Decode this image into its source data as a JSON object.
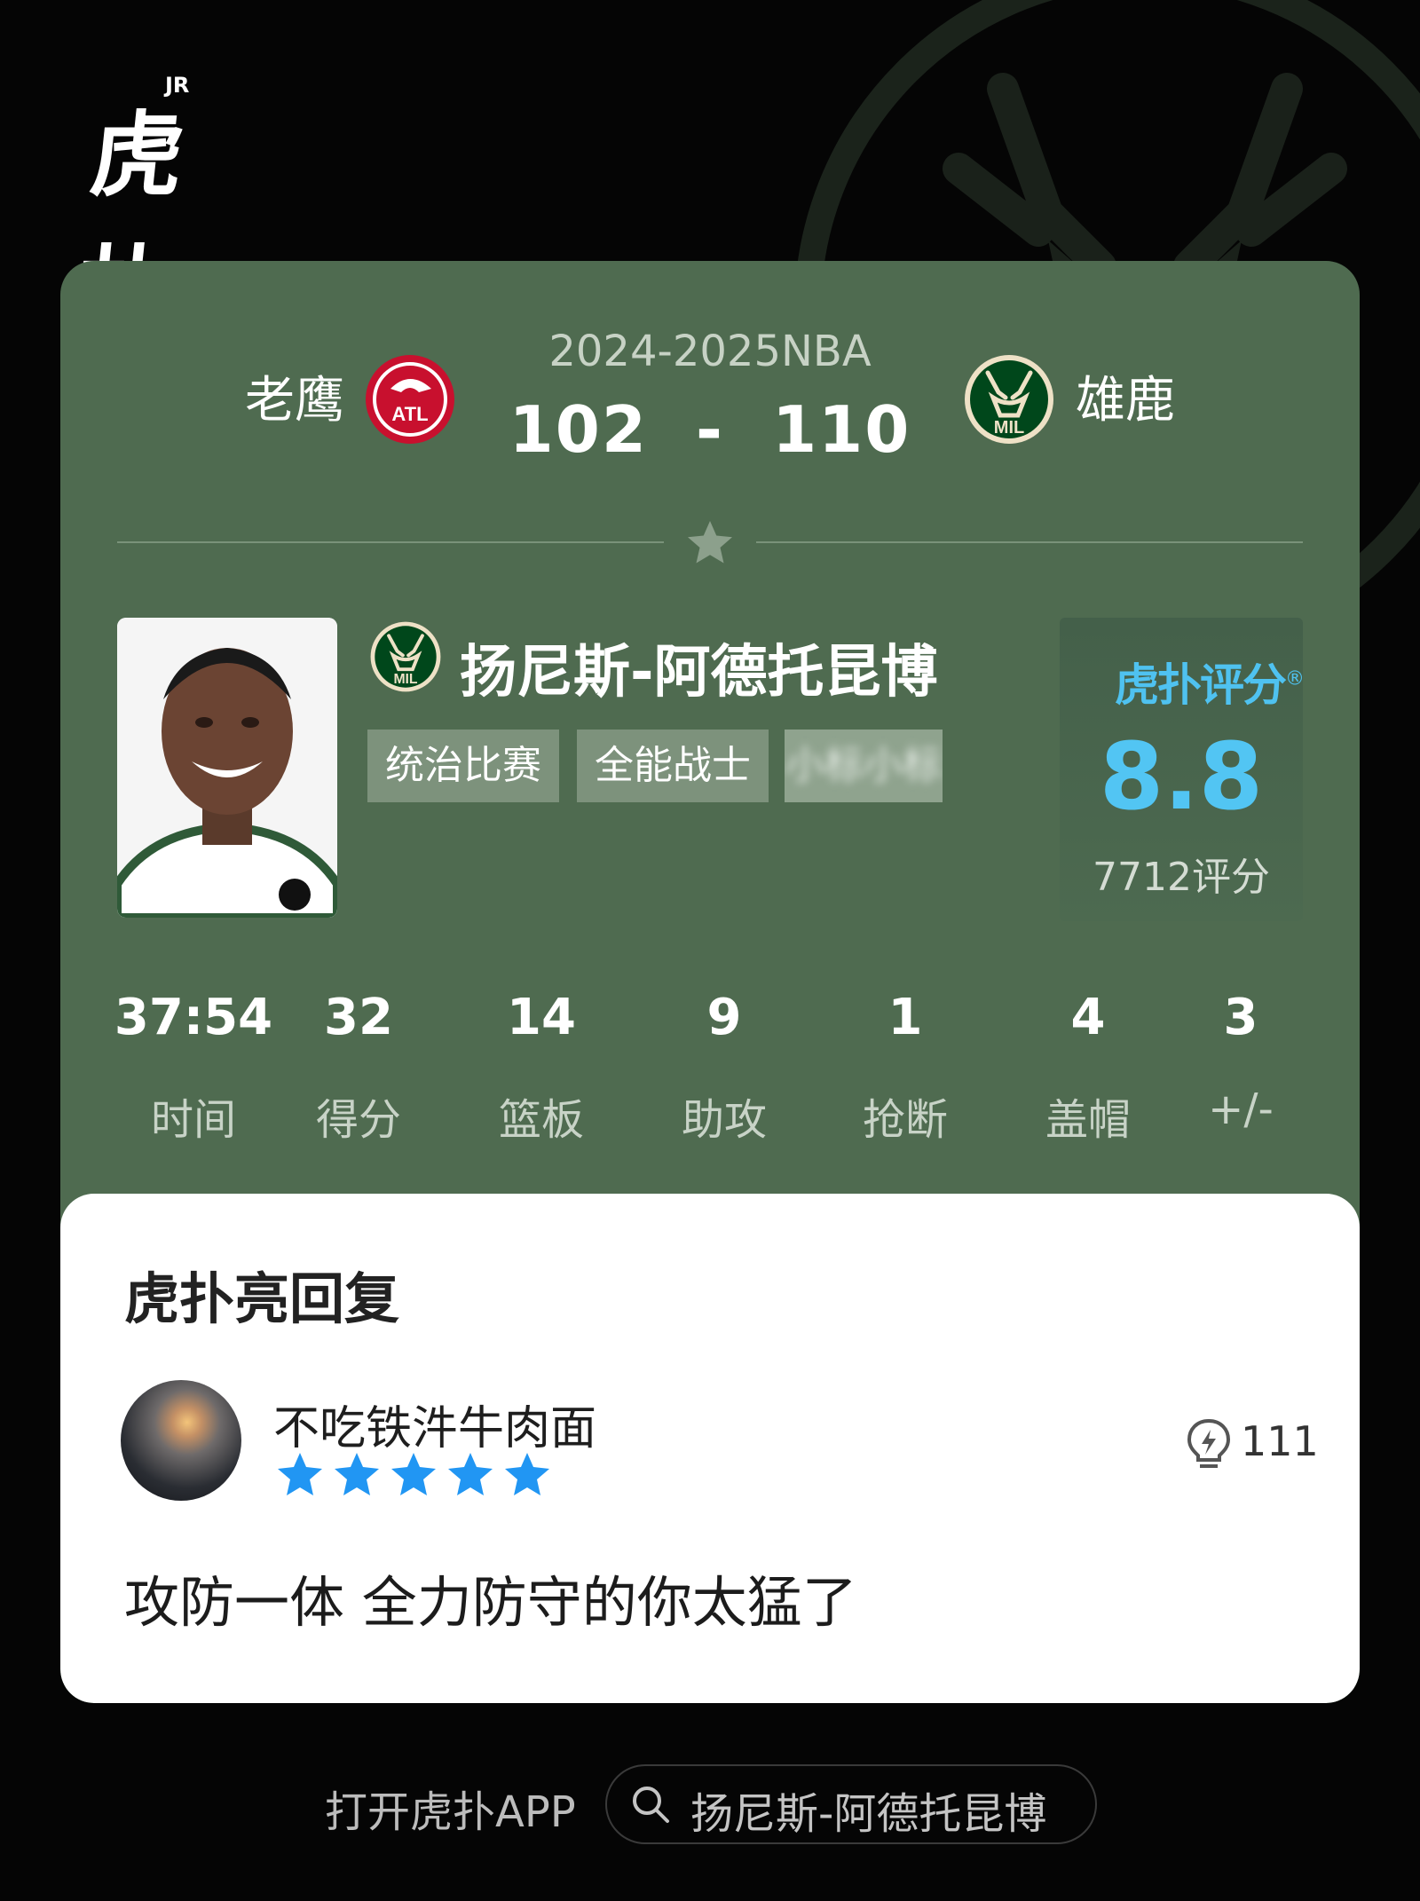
{
  "app": {
    "brand": "虎扑",
    "brand_badge": "JR"
  },
  "colors": {
    "card_bg": "#4f6b50",
    "rating_blue": "#52c5f3",
    "star_blue": "#2196f3",
    "atl_red": "#c8102e",
    "mil_green": "#00471b",
    "mil_cream": "#eee1c6"
  },
  "game": {
    "season": "2024-2025NBA",
    "home_team": "老鹰",
    "home_logo_text": "ATL",
    "away_team": "雄鹿",
    "away_logo_text": "MIL",
    "score": "102  -  110"
  },
  "player": {
    "name": "扬尼斯-阿德托昆博",
    "team_logo": "MIL",
    "tags": [
      "统治比赛",
      "全能战士",
      "小标小标"
    ]
  },
  "rating": {
    "logo": "虎扑评分",
    "logo_mark": "®",
    "value": "8.8",
    "count": "7712评分"
  },
  "stats": [
    {
      "value": "37:54",
      "label": "时间"
    },
    {
      "value": "32",
      "label": "得分"
    },
    {
      "value": "14",
      "label": "篮板"
    },
    {
      "value": "9",
      "label": "助攻"
    },
    {
      "value": "1",
      "label": "抢断"
    },
    {
      "value": "4",
      "label": "盖帽"
    },
    {
      "value": "3",
      "label": "+/-"
    }
  ],
  "reply": {
    "title": "虎扑亮回复",
    "user_name": "不吃铁汼牛肉面",
    "user_stars": 5,
    "likes": "111",
    "content": "攻防一体 全力防守的你太猛了"
  },
  "footer": {
    "open_app": "打开虎扑APP",
    "search_text": "扬尼斯-阿德托昆博"
  },
  "icons": {
    "search": "search-icon",
    "like": "lightbulb-icon",
    "star": "star-icon"
  }
}
